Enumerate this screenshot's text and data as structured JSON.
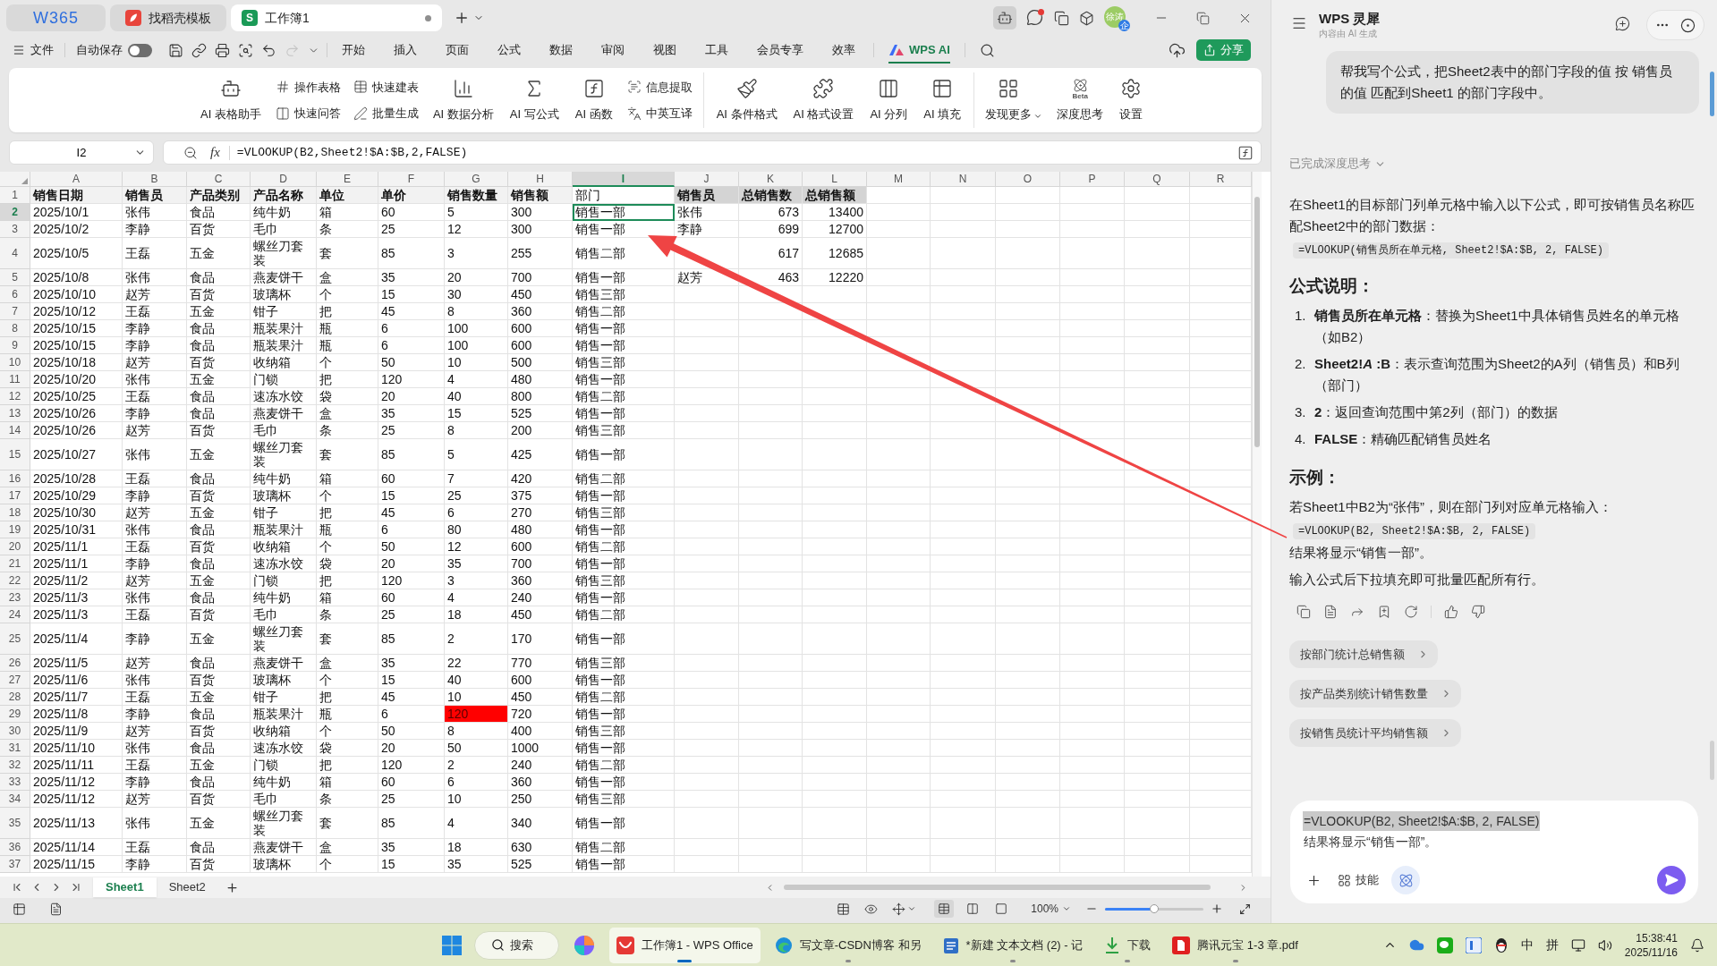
{
  "window_tabs": {
    "tabs": [
      {
        "kind": "logo",
        "label": "W365",
        "selected": false,
        "modified": false
      },
      {
        "kind": "template",
        "label": "找稻壳模板",
        "selected": false,
        "modified": false
      },
      {
        "kind": "sheet",
        "badge": "S",
        "label": "工作簿1",
        "selected": true,
        "modified": true
      }
    ],
    "avatar": {
      "initials": "徐涛",
      "badge": "企"
    }
  },
  "menu_bar": {
    "file_label": "文件",
    "autosave": {
      "label": "自动保存",
      "on": false
    },
    "quick_access": [
      {
        "kind": "save",
        "disabled": false
      },
      {
        "kind": "link",
        "disabled": false
      },
      {
        "kind": "print",
        "disabled": false
      },
      {
        "kind": "preview",
        "disabled": false
      },
      {
        "kind": "undo",
        "disabled": false
      },
      {
        "kind": "redo",
        "disabled": true
      },
      {
        "kind": "more",
        "disabled": false
      }
    ],
    "tabs": [
      {
        "kind": "text",
        "label": "开始",
        "selected": false
      },
      {
        "kind": "text",
        "label": "插入",
        "selected": false
      },
      {
        "kind": "text",
        "label": "页面",
        "selected": false
      },
      {
        "kind": "text",
        "label": "公式",
        "selected": false
      },
      {
        "kind": "text",
        "label": "数据",
        "selected": false
      },
      {
        "kind": "text",
        "label": "审阅",
        "selected": false
      },
      {
        "kind": "text",
        "label": "视图",
        "selected": false
      },
      {
        "kind": "text",
        "label": "工具",
        "selected": false
      },
      {
        "kind": "text",
        "label": "会员专享",
        "selected": false
      },
      {
        "kind": "text",
        "label": "效率",
        "selected": false
      },
      {
        "kind": "ai",
        "label": "WPS AI",
        "selected": true
      }
    ],
    "share_label": "分享"
  },
  "ribbon": {
    "groups": [
      {
        "items": [
          {
            "kind": "large",
            "label": "AI 表格助手"
          },
          {
            "kind": "pair",
            "items": [
              {
                "label": "操作表格"
              },
              {
                "label": "快速问答"
              }
            ]
          },
          {
            "kind": "pair",
            "items": [
              {
                "label": "快速建表"
              },
              {
                "label": "批量生成"
              }
            ]
          },
          {
            "kind": "large",
            "label": "AI 数据分析"
          },
          {
            "kind": "large",
            "label": "AI 写公式"
          },
          {
            "kind": "large",
            "label": "AI 函数"
          },
          {
            "kind": "pair",
            "items": [
              {
                "label": "信息提取"
              },
              {
                "label": "中英互译"
              }
            ]
          }
        ]
      },
      {
        "items": [
          {
            "kind": "large",
            "label": "AI 条件格式"
          },
          {
            "kind": "large",
            "label": "AI 格式设置"
          },
          {
            "kind": "large",
            "label": "AI 分列"
          },
          {
            "kind": "large",
            "label": "AI 填充"
          }
        ]
      },
      {
        "items": [
          {
            "kind": "large",
            "label": "发现更多",
            "has_menu": true
          },
          {
            "kind": "large",
            "label": "深度思考",
            "badge": "Beta"
          },
          {
            "kind": "large",
            "label": "设置"
          }
        ]
      }
    ]
  },
  "formula_bar": {
    "name_box": "I2",
    "function_label": "fx",
    "formula": "=VLOOKUP(B2,Sheet2!$A:$B,2,FALSE)"
  },
  "sheet": {
    "columns": [
      {
        "label": "A",
        "selected": false
      },
      {
        "label": "B",
        "selected": false
      },
      {
        "label": "C",
        "selected": false
      },
      {
        "label": "D",
        "selected": false
      },
      {
        "label": "E",
        "selected": false
      },
      {
        "label": "F",
        "selected": false
      },
      {
        "label": "G",
        "selected": false
      },
      {
        "label": "H",
        "selected": false
      },
      {
        "label": "I",
        "selected": true
      },
      {
        "label": "J",
        "selected": false
      },
      {
        "label": "K",
        "selected": false
      },
      {
        "label": "L",
        "selected": false
      },
      {
        "label": "M",
        "selected": false
      },
      {
        "label": "N",
        "selected": false
      },
      {
        "label": "O",
        "selected": false
      },
      {
        "label": "P",
        "selected": false
      },
      {
        "label": "Q",
        "selected": false
      },
      {
        "label": "R",
        "selected": false
      }
    ],
    "header_row": {
      "number": "1",
      "selected": false,
      "cells": [
        {
          "text": "销售日期",
          "bold": true
        },
        {
          "text": "销售员",
          "bold": true
        },
        {
          "text": "产品类别",
          "bold": true
        },
        {
          "text": "产品名称",
          "bold": true
        },
        {
          "text": "单位",
          "bold": true
        },
        {
          "text": "单价",
          "bold": true
        },
        {
          "text": "销售数量",
          "bold": true
        },
        {
          "text": "销售额",
          "bold": true
        },
        {
          "text": "部门",
          "bold": false
        }
      ]
    },
    "rows": [
      {
        "number": "2",
        "selected": true,
        "quantity_highlighted": false,
        "cells": [
          "2025/10/1",
          "张伟",
          "食品",
          "纯牛奶",
          "箱",
          "60",
          "5",
          "300",
          "销售一部"
        ]
      },
      {
        "number": "3",
        "selected": false,
        "quantity_highlighted": false,
        "cells": [
          "2025/10/2",
          "李静",
          "百货",
          "毛巾",
          "条",
          "25",
          "12",
          "300",
          "销售一部"
        ]
      },
      {
        "number": "4",
        "selected": false,
        "quantity_highlighted": false,
        "cells": [
          "2025/10/5",
          "王磊",
          "五金",
          "螺丝刀套装",
          "套",
          "85",
          "3",
          "255",
          "销售二部"
        ]
      },
      {
        "number": "5",
        "selected": false,
        "quantity_highlighted": false,
        "cells": [
          "2025/10/8",
          "张伟",
          "食品",
          "燕麦饼干",
          "盒",
          "35",
          "20",
          "700",
          "销售一部"
        ]
      },
      {
        "number": "6",
        "selected": false,
        "quantity_highlighted": false,
        "cells": [
          "2025/10/10",
          "赵芳",
          "百货",
          "玻璃杯",
          "个",
          "15",
          "30",
          "450",
          "销售三部"
        ]
      },
      {
        "number": "7",
        "selected": false,
        "quantity_highlighted": false,
        "cells": [
          "2025/10/12",
          "王磊",
          "五金",
          "钳子",
          "把",
          "45",
          "8",
          "360",
          "销售二部"
        ]
      },
      {
        "number": "8",
        "selected": false,
        "quantity_highlighted": false,
        "cells": [
          "2025/10/15",
          "李静",
          "食品",
          "瓶装果汁",
          "瓶",
          "6",
          "100",
          "600",
          "销售一部"
        ]
      },
      {
        "number": "9",
        "selected": false,
        "quantity_highlighted": false,
        "cells": [
          "2025/10/15",
          "李静",
          "食品",
          "瓶装果汁",
          "瓶",
          "6",
          "100",
          "600",
          "销售一部"
        ]
      },
      {
        "number": "10",
        "selected": false,
        "quantity_highlighted": false,
        "cells": [
          "2025/10/18",
          "赵芳",
          "百货",
          "收纳箱",
          "个",
          "50",
          "10",
          "500",
          "销售三部"
        ]
      },
      {
        "number": "11",
        "selected": false,
        "quantity_highlighted": false,
        "cells": [
          "2025/10/20",
          "张伟",
          "五金",
          "门锁",
          "把",
          "120",
          "4",
          "480",
          "销售一部"
        ]
      },
      {
        "number": "12",
        "selected": false,
        "quantity_highlighted": false,
        "cells": [
          "2025/10/25",
          "王磊",
          "食品",
          "速冻水饺",
          "袋",
          "20",
          "40",
          "800",
          "销售二部"
        ]
      },
      {
        "number": "13",
        "selected": false,
        "quantity_highlighted": false,
        "cells": [
          "2025/10/26",
          "李静",
          "食品",
          "燕麦饼干",
          "盒",
          "35",
          "15",
          "525",
          "销售一部"
        ]
      },
      {
        "number": "14",
        "selected": false,
        "quantity_highlighted": false,
        "cells": [
          "2025/10/26",
          "赵芳",
          "百货",
          "毛巾",
          "条",
          "25",
          "8",
          "200",
          "销售三部"
        ]
      },
      {
        "number": "15",
        "selected": false,
        "quantity_highlighted": false,
        "cells": [
          "2025/10/27",
          "张伟",
          "五金",
          "螺丝刀套装",
          "套",
          "85",
          "5",
          "425",
          "销售一部"
        ]
      },
      {
        "number": "16",
        "selected": false,
        "quantity_highlighted": false,
        "cells": [
          "2025/10/28",
          "王磊",
          "食品",
          "纯牛奶",
          "箱",
          "60",
          "7",
          "420",
          "销售二部"
        ]
      },
      {
        "number": "17",
        "selected": false,
        "quantity_highlighted": false,
        "cells": [
          "2025/10/29",
          "李静",
          "百货",
          "玻璃杯",
          "个",
          "15",
          "25",
          "375",
          "销售一部"
        ]
      },
      {
        "number": "18",
        "selected": false,
        "quantity_highlighted": false,
        "cells": [
          "2025/10/30",
          "赵芳",
          "五金",
          "钳子",
          "把",
          "45",
          "6",
          "270",
          "销售三部"
        ]
      },
      {
        "number": "19",
        "selected": false,
        "quantity_highlighted": false,
        "cells": [
          "2025/10/31",
          "张伟",
          "食品",
          "瓶装果汁",
          "瓶",
          "6",
          "80",
          "480",
          "销售一部"
        ]
      },
      {
        "number": "20",
        "selected": false,
        "quantity_highlighted": false,
        "cells": [
          "2025/11/1",
          "王磊",
          "百货",
          "收纳箱",
          "个",
          "50",
          "12",
          "600",
          "销售二部"
        ]
      },
      {
        "number": "21",
        "selected": false,
        "quantity_highlighted": false,
        "cells": [
          "2025/11/1",
          "李静",
          "食品",
          "速冻水饺",
          "袋",
          "20",
          "35",
          "700",
          "销售一部"
        ]
      },
      {
        "number": "22",
        "selected": false,
        "quantity_highlighted": false,
        "cells": [
          "2025/11/2",
          "赵芳",
          "五金",
          "门锁",
          "把",
          "120",
          "3",
          "360",
          "销售三部"
        ]
      },
      {
        "number": "23",
        "selected": false,
        "quantity_highlighted": false,
        "cells": [
          "2025/11/3",
          "张伟",
          "食品",
          "纯牛奶",
          "箱",
          "60",
          "4",
          "240",
          "销售一部"
        ]
      },
      {
        "number": "24",
        "selected": false,
        "quantity_highlighted": false,
        "cells": [
          "2025/11/3",
          "王磊",
          "百货",
          "毛巾",
          "条",
          "25",
          "18",
          "450",
          "销售二部"
        ]
      },
      {
        "number": "25",
        "selected": false,
        "quantity_highlighted": false,
        "cells": [
          "2025/11/4",
          "李静",
          "五金",
          "螺丝刀套装",
          "套",
          "85",
          "2",
          "170",
          "销售一部"
        ]
      },
      {
        "number": "26",
        "selected": false,
        "quantity_highlighted": false,
        "cells": [
          "2025/11/5",
          "赵芳",
          "食品",
          "燕麦饼干",
          "盒",
          "35",
          "22",
          "770",
          "销售三部"
        ]
      },
      {
        "number": "27",
        "selected": false,
        "quantity_highlighted": false,
        "cells": [
          "2025/11/6",
          "张伟",
          "百货",
          "玻璃杯",
          "个",
          "15",
          "40",
          "600",
          "销售一部"
        ]
      },
      {
        "number": "28",
        "selected": false,
        "quantity_highlighted": false,
        "cells": [
          "2025/11/7",
          "王磊",
          "五金",
          "钳子",
          "把",
          "45",
          "10",
          "450",
          "销售二部"
        ]
      },
      {
        "number": "29",
        "selected": false,
        "quantity_highlighted": true,
        "cells": [
          "2025/11/8",
          "李静",
          "食品",
          "瓶装果汁",
          "瓶",
          "6",
          "120",
          "720",
          "销售一部"
        ]
      },
      {
        "number": "30",
        "selected": false,
        "quantity_highlighted": false,
        "cells": [
          "2025/11/9",
          "赵芳",
          "百货",
          "收纳箱",
          "个",
          "50",
          "8",
          "400",
          "销售三部"
        ]
      },
      {
        "number": "31",
        "selected": false,
        "quantity_highlighted": false,
        "cells": [
          "2025/11/10",
          "张伟",
          "食品",
          "速冻水饺",
          "袋",
          "20",
          "50",
          "1000",
          "销售一部"
        ]
      },
      {
        "number": "32",
        "selected": false,
        "quantity_highlighted": false,
        "cells": [
          "2025/11/11",
          "王磊",
          "五金",
          "门锁",
          "把",
          "120",
          "2",
          "240",
          "销售二部"
        ]
      },
      {
        "number": "33",
        "selected": false,
        "quantity_highlighted": false,
        "cells": [
          "2025/11/12",
          "李静",
          "食品",
          "纯牛奶",
          "箱",
          "60",
          "6",
          "360",
          "销售一部"
        ]
      },
      {
        "number": "34",
        "selected": false,
        "quantity_highlighted": false,
        "cells": [
          "2025/11/12",
          "赵芳",
          "百货",
          "毛巾",
          "条",
          "25",
          "10",
          "250",
          "销售三部"
        ]
      },
      {
        "number": "35",
        "selected": false,
        "quantity_highlighted": false,
        "cells": [
          "2025/11/13",
          "张伟",
          "五金",
          "螺丝刀套装",
          "套",
          "85",
          "4",
          "340",
          "销售一部"
        ]
      },
      {
        "number": "36",
        "selected": false,
        "quantity_highlighted": false,
        "cells": [
          "2025/11/14",
          "王磊",
          "食品",
          "燕麦饼干",
          "盒",
          "35",
          "18",
          "630",
          "销售二部"
        ]
      },
      {
        "number": "37",
        "selected": false,
        "quantity_highlighted": false,
        "cells": [
          "2025/11/15",
          "李静",
          "百货",
          "玻璃杯",
          "个",
          "15",
          "35",
          "525",
          "销售一部"
        ]
      }
    ],
    "summary": {
      "header": [
        "销售员",
        "总销售数",
        "总销售额"
      ],
      "rows": [
        {
          "salesperson": "张伟",
          "total_quantity": "673",
          "total_amount": "13400"
        },
        {
          "salesperson": "李静",
          "total_quantity": "699",
          "total_amount": "12700"
        },
        {
          "total_quantity": "617",
          "total_amount": "12685"
        },
        {
          "salesperson": "赵芳",
          "total_quantity": "463",
          "total_amount": "12220"
        }
      ]
    }
  },
  "sheet_tabs": {
    "tabs": [
      {
        "label": "Sheet1",
        "selected": true
      },
      {
        "label": "Sheet2",
        "selected": false
      }
    ]
  },
  "status_bar": {
    "view_modes": [
      {
        "kind": "normal",
        "selected": true
      },
      {
        "kind": "layout",
        "selected": false
      },
      {
        "kind": "page",
        "selected": false
      }
    ],
    "zoom": {
      "label": "100%",
      "level": 0.5
    }
  },
  "ai_panel": {
    "title": "WPS 灵犀",
    "subtitle": "内容由 AI 生成",
    "user_message": "帮我写个公式，把Sheet2表中的部门字段的值 按 销售员的值 匹配到Sheet1 的部门字段中。",
    "thinking_status": "已完成深度思考",
    "answer": [
      {
        "kind": "paragraph",
        "text": "在Sheet1的目标部门列单元格中输入以下公式，即可按销售员名称匹配Sheet2中的部门数据："
      },
      {
        "kind": "code",
        "text": "=VLOOKUP(销售员所在单元格, Sheet2!$A:$B, 2, FALSE)"
      },
      {
        "kind": "heading",
        "text": "公式说明："
      },
      {
        "kind": "list",
        "items": [
          {
            "number": "1.",
            "term": "销售员所在单元格",
            "text": "：替换为Sheet1中具体销售员姓名的单元格（如B2）"
          },
          {
            "number": "2.",
            "term": "Sheet2!*A* :B",
            "text": "：表示查询范围为Sheet2的A列（销售员）和B列（部门）"
          },
          {
            "number": "3.",
            "term": "2",
            "text": "：返回查询范围中第2列（部门）的数据"
          },
          {
            "number": "4.",
            "term": "FALSE",
            "text": "：精确匹配销售员姓名"
          }
        ]
      },
      {
        "kind": "heading",
        "text": "示例："
      },
      {
        "kind": "paragraph",
        "text": "若Sheet1中B2为“张伟”，则在部门列对应单元格输入："
      },
      {
        "kind": "code",
        "text": "=VLOOKUP(B2, Sheet2!$A:$B, 2, FALSE)"
      },
      {
        "kind": "paragraph",
        "text": "结果将显示“销售一部”。"
      },
      {
        "kind": "paragraph",
        "text": "输入公式后下拉填充即可批量匹配所有行。"
      }
    ],
    "suggestions": [
      "按部门统计总销售额",
      "按产品类别统计销售数量",
      "按销售员统计平均销售额"
    ],
    "input": {
      "lines": [
        {
          "text": "=VLOOKUP(B2, Sheet2!$A:$B, 2, FALSE)",
          "selected": true
        },
        {
          "text": "结果将显示“销售一部”。",
          "selected": false
        }
      ],
      "skills_label": "技能"
    }
  },
  "taskbar": {
    "search_label": "搜索",
    "apps": [
      {
        "kind": "wps",
        "label": "工作簿1 - WPS Office",
        "active": true
      },
      {
        "kind": "browser",
        "label": "写文章-CSDN博客 和另",
        "active": false
      },
      {
        "kind": "notepad",
        "label": "*新建 文本文档 (2) - 记",
        "active": false
      },
      {
        "kind": "download",
        "label": "下载",
        "active": false
      },
      {
        "kind": "pdf",
        "label": "腾讯元宝 1-3 章.pdf",
        "active": false
      }
    ],
    "ime": [
      "中",
      "拼"
    ],
    "time": "15:38:41",
    "date": "2025/11/16"
  }
}
